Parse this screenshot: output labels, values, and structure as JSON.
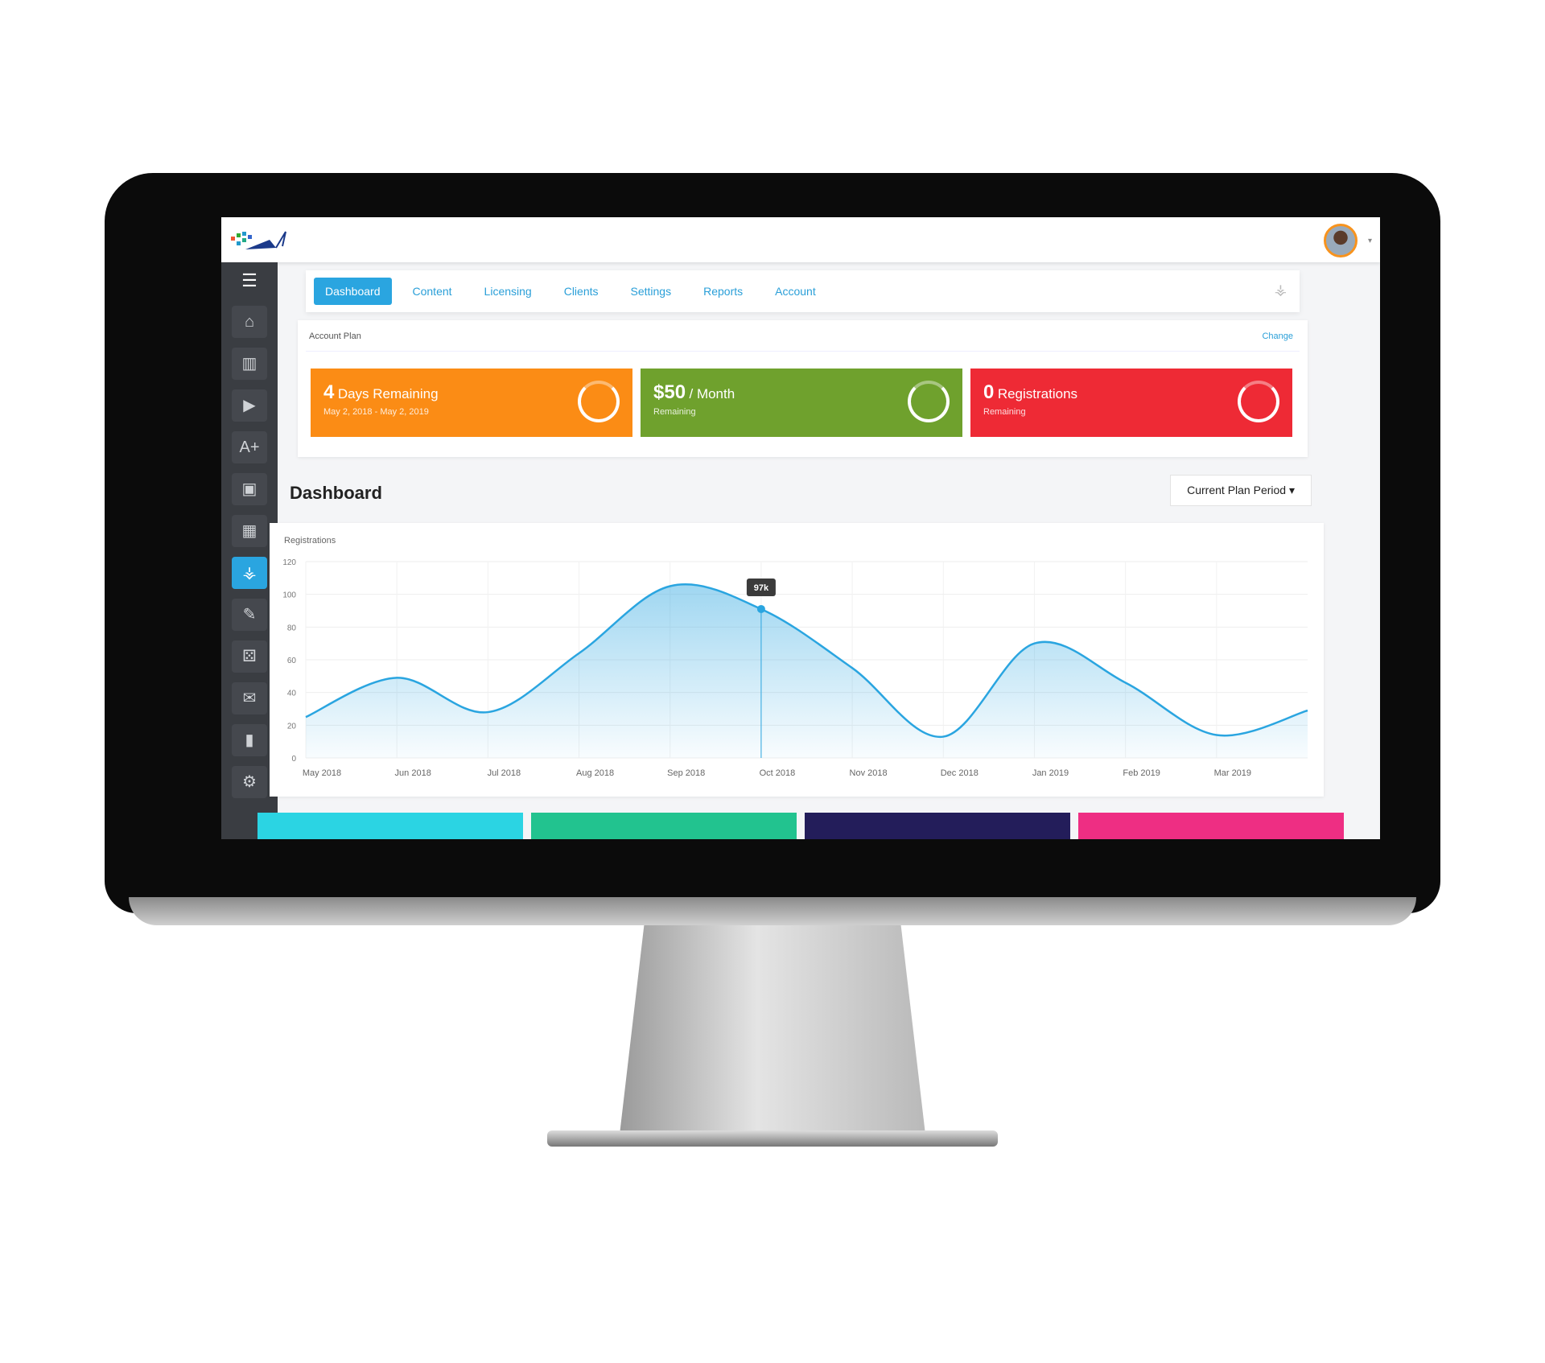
{
  "header": {
    "logo": "logo",
    "avatar": "user-avatar"
  },
  "tabs": [
    {
      "label": "Dashboard",
      "active": true
    },
    {
      "label": "Content"
    },
    {
      "label": "Licensing"
    },
    {
      "label": "Clients"
    },
    {
      "label": "Settings"
    },
    {
      "label": "Reports"
    },
    {
      "label": "Account"
    }
  ],
  "sidebar": {
    "items": [
      {
        "icon": "home-icon",
        "glyph": "⌂"
      },
      {
        "icon": "book-icon",
        "glyph": "▥"
      },
      {
        "icon": "media-icon",
        "glyph": "▶"
      },
      {
        "icon": "text-add-icon",
        "glyph": "A+"
      },
      {
        "icon": "calendar-icon",
        "glyph": "▣"
      },
      {
        "icon": "grid-icon",
        "glyph": "▦"
      },
      {
        "icon": "antenna-icon",
        "glyph": "⚶",
        "active": true
      },
      {
        "icon": "edit-icon",
        "glyph": "✎"
      },
      {
        "icon": "dice-icon",
        "glyph": "⚄"
      },
      {
        "icon": "chat-icon",
        "glyph": "✉"
      },
      {
        "icon": "bar-chart-icon",
        "glyph": "▮"
      },
      {
        "icon": "gear-icon",
        "glyph": "⚙"
      }
    ]
  },
  "plan": {
    "label": "Account Plan",
    "change": "Change",
    "cards": [
      {
        "big": "4",
        "unit": "Days Remaining",
        "sub": "May 2, 2018 - May 2, 2019",
        "color": "#fb8c15"
      },
      {
        "big": "$50",
        "unit": "/ Month",
        "sub": "Remaining",
        "color": "#6fa12d"
      },
      {
        "big": "0",
        "unit": "Registrations",
        "sub": "Remaining",
        "color": "#ee2a35"
      }
    ]
  },
  "dashboard": {
    "title": "Dashboard",
    "period": "Current Plan Period"
  },
  "chart_data": {
    "type": "area",
    "title": "Registrations",
    "ylim": [
      0,
      120
    ],
    "yticks": [
      0,
      20,
      40,
      60,
      80,
      100,
      120
    ],
    "grid": true,
    "categories": [
      "May 2018",
      "Jun 2018",
      "Jul 2018",
      "Aug 2018",
      "Sep 2018",
      "Oct 2018",
      "Nov 2018",
      "Dec 2018",
      "Jan 2019",
      "Feb 2019",
      "Mar 2019"
    ],
    "values": [
      25,
      49,
      28,
      64,
      105,
      91,
      55,
      13,
      70,
      46,
      14,
      29
    ],
    "tooltip": {
      "index": 5,
      "label": "97k"
    },
    "color": "#2aa5e0"
  },
  "bottom_colors": [
    "#2bd4e3",
    "#22c38f",
    "#231d5a",
    "#ee2e83"
  ]
}
